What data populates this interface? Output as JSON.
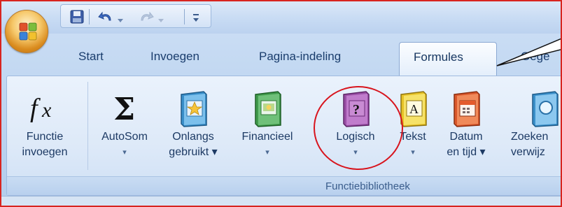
{
  "tabs": {
    "start": "Start",
    "invoegen": "Invoegen",
    "pagina_indeling": "Pagina-indeling",
    "formules": "Formules",
    "gegevens_partial": "Gege"
  },
  "ribbon": {
    "group_label": "Functiebibliotheek",
    "commands": [
      {
        "line1": "Functie",
        "line2": "invoegen",
        "icon": "fx-icon"
      },
      {
        "line1": "AutoSom",
        "line2": "▾",
        "icon": "sigma-icon"
      },
      {
        "line1": "Onlangs",
        "line2": "gebruikt ▾",
        "icon": "book-star-icon"
      },
      {
        "line1": "Financieel",
        "line2": "▾",
        "icon": "book-money-icon"
      },
      {
        "line1": "Logisch",
        "line2": "▾",
        "icon": "book-question-icon"
      },
      {
        "line1": "Tekst",
        "line2": "▾",
        "icon": "book-text-icon"
      },
      {
        "line1": "Datum",
        "line2": "en tijd ▾",
        "icon": "book-calendar-icon"
      },
      {
        "line1": "Zoeken",
        "line2": "verwijz",
        "icon": "book-search-icon"
      }
    ]
  },
  "colors": {
    "highlight": "#d8141d",
    "ribbon_text": "#1d3a64"
  }
}
